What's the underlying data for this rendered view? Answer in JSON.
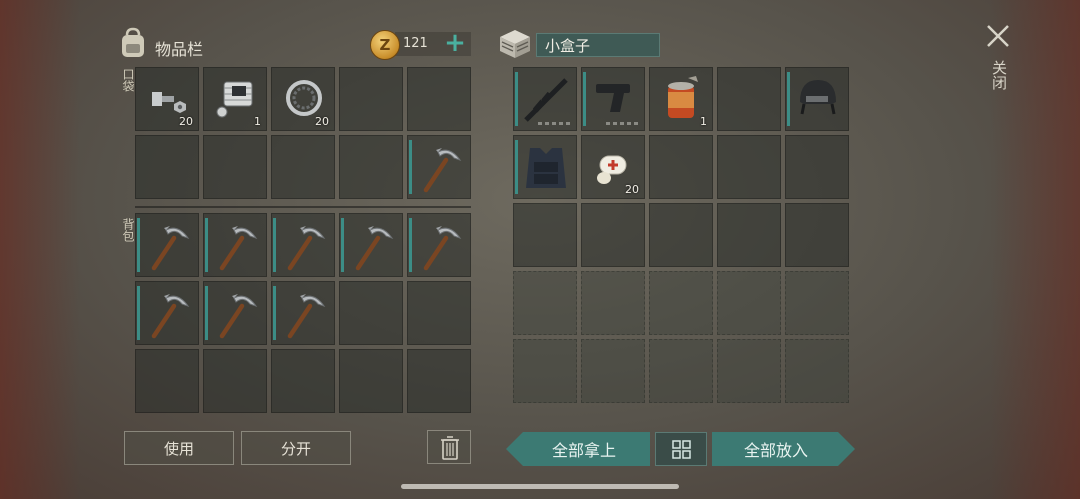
{
  "inventory": {
    "title": "物品栏",
    "coins": "121",
    "pocket_label": "口袋",
    "backpack_label": "背包",
    "pocket_slots": [
      {
        "item": "bolt-icon",
        "count": "20",
        "bar": false
      },
      {
        "item": "engine-part-icon",
        "count": "1",
        "bar": false
      },
      {
        "item": "bearing-icon",
        "count": "20",
        "bar": false
      },
      {
        "item": "",
        "count": "",
        "bar": false
      },
      {
        "item": "",
        "count": "",
        "bar": false
      },
      {
        "item": "",
        "count": "",
        "bar": false
      },
      {
        "item": "",
        "count": "",
        "bar": false
      },
      {
        "item": "",
        "count": "",
        "bar": false
      },
      {
        "item": "",
        "count": "",
        "bar": false
      },
      {
        "item": "pickaxe-icon",
        "count": "",
        "bar": true
      }
    ],
    "backpack_slots": [
      {
        "item": "pickaxe-icon",
        "count": "",
        "bar": true
      },
      {
        "item": "pickaxe-icon",
        "count": "",
        "bar": true
      },
      {
        "item": "pickaxe-icon",
        "count": "",
        "bar": true
      },
      {
        "item": "pickaxe-icon",
        "count": "",
        "bar": true
      },
      {
        "item": "pickaxe-icon",
        "count": "",
        "bar": true
      },
      {
        "item": "pickaxe-icon",
        "count": "",
        "bar": true
      },
      {
        "item": "pickaxe-icon",
        "count": "",
        "bar": true
      },
      {
        "item": "pickaxe-icon",
        "count": "",
        "bar": true
      },
      {
        "item": "",
        "count": "",
        "bar": false
      },
      {
        "item": "",
        "count": "",
        "bar": false
      },
      {
        "item": "",
        "count": "",
        "bar": false
      },
      {
        "item": "",
        "count": "",
        "bar": false
      },
      {
        "item": "",
        "count": "",
        "bar": false
      },
      {
        "item": "",
        "count": "",
        "bar": false
      },
      {
        "item": "",
        "count": "",
        "bar": false
      }
    ],
    "use_label": "使用",
    "split_label": "分开"
  },
  "box": {
    "name": "小盒子",
    "slots": [
      {
        "item": "rifle-icon",
        "count": "",
        "bar": true,
        "dots": true
      },
      {
        "item": "pistol-icon",
        "count": "",
        "bar": true,
        "dots": true
      },
      {
        "item": "canned-food-icon",
        "count": "1",
        "bar": false,
        "dots": false
      },
      {
        "item": "",
        "count": "",
        "bar": false,
        "dots": false
      },
      {
        "item": "helmet-icon",
        "count": "",
        "bar": true,
        "dots": false
      },
      {
        "item": "armor-vest-icon",
        "count": "",
        "bar": true,
        "dots": false
      },
      {
        "item": "bandage-icon",
        "count": "20",
        "bar": false,
        "dots": false
      }
    ],
    "take_all_label": "全部拿上",
    "put_all_label": "全部放入"
  },
  "close_label": "关闭",
  "colors": {
    "accent": "#3c7a73",
    "coin": "#c88d2a",
    "bar": "#3c8d86"
  }
}
